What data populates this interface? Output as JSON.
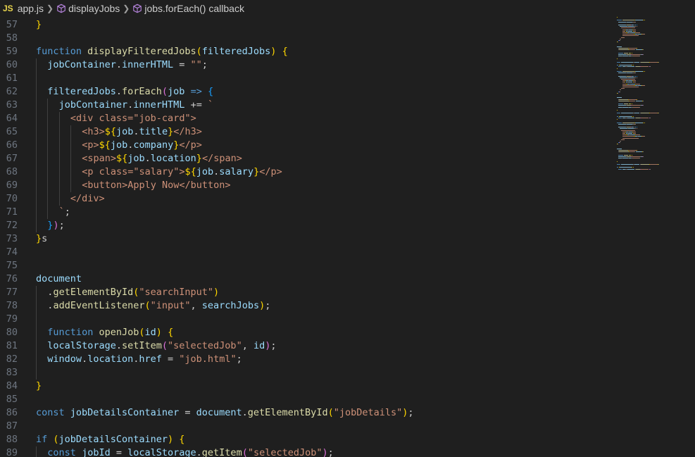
{
  "breadcrumb": {
    "file_badge": "JS",
    "file": "app.js",
    "symbol1": "displayJobs",
    "symbol2": "jobs.forEach() callback",
    "separator": ">",
    "symbol_icon": "cube-icon"
  },
  "colors": {
    "background": "#1f1f1f",
    "keyword": "#569cd6",
    "function": "#dcdcaa",
    "variable": "#9cdcfe",
    "string": "#ce9178",
    "bracket_gold": "#ffd700",
    "bracket_purple": "#da70d6",
    "bracket_blue": "#179fff",
    "line_number": "#6e7681"
  },
  "lines": [
    {
      "n": "57",
      "indent": 0,
      "tokens": [
        [
          "}",
          "b1"
        ]
      ]
    },
    {
      "n": "58",
      "indent": 0,
      "tokens": []
    },
    {
      "n": "59",
      "indent": 0,
      "tokens": [
        [
          "function",
          "kw"
        ],
        [
          " ",
          ""
        ],
        [
          "displayFilteredJobs",
          "fn"
        ],
        [
          "(",
          "b1"
        ],
        [
          "filteredJobs",
          "var"
        ],
        [
          ")",
          "b1"
        ],
        [
          " ",
          ""
        ],
        [
          "{",
          "b1"
        ]
      ]
    },
    {
      "n": "60",
      "indent": 1,
      "tokens": [
        [
          "jobContainer",
          "var"
        ],
        [
          ".",
          ""
        ],
        [
          "innerHTML",
          "var"
        ],
        [
          " = ",
          ""
        ],
        [
          "\"\"",
          "str"
        ],
        [
          ";",
          ""
        ]
      ]
    },
    {
      "n": "61",
      "indent": 1,
      "tokens": []
    },
    {
      "n": "62",
      "indent": 1,
      "tokens": [
        [
          "filteredJobs",
          "var"
        ],
        [
          ".",
          ""
        ],
        [
          "forEach",
          "fn"
        ],
        [
          "(",
          "b2"
        ],
        [
          "job",
          "var"
        ],
        [
          " ",
          ""
        ],
        [
          "=>",
          "kw"
        ],
        [
          " ",
          ""
        ],
        [
          "{",
          "b3"
        ]
      ]
    },
    {
      "n": "63",
      "indent": 2,
      "tokens": [
        [
          "jobContainer",
          "var"
        ],
        [
          ".",
          ""
        ],
        [
          "innerHTML",
          "var"
        ],
        [
          " += ",
          ""
        ],
        [
          "`",
          "str"
        ]
      ]
    },
    {
      "n": "64",
      "indent": 3,
      "tokens": [
        [
          "<div class=\"job-card\">",
          "str"
        ]
      ]
    },
    {
      "n": "65",
      "indent": 4,
      "tokens": [
        [
          "<h3>",
          "str"
        ],
        [
          "${",
          "b1"
        ],
        [
          "job",
          "var"
        ],
        [
          ".",
          ""
        ],
        [
          "title",
          "var"
        ],
        [
          "}",
          "b1"
        ],
        [
          "</h3>",
          "str"
        ]
      ]
    },
    {
      "n": "66",
      "indent": 4,
      "tokens": [
        [
          "<p>",
          "str"
        ],
        [
          "${",
          "b1"
        ],
        [
          "job",
          "var"
        ],
        [
          ".",
          ""
        ],
        [
          "company",
          "var"
        ],
        [
          "}",
          "b1"
        ],
        [
          "</p>",
          "str"
        ]
      ]
    },
    {
      "n": "67",
      "indent": 4,
      "tokens": [
        [
          "<span>",
          "str"
        ],
        [
          "${",
          "b1"
        ],
        [
          "job",
          "var"
        ],
        [
          ".",
          ""
        ],
        [
          "location",
          "var"
        ],
        [
          "}",
          "b1"
        ],
        [
          "</span>",
          "str"
        ]
      ]
    },
    {
      "n": "68",
      "indent": 4,
      "tokens": [
        [
          "<p class=\"salary\">",
          "str"
        ],
        [
          "${",
          "b1"
        ],
        [
          "job",
          "var"
        ],
        [
          ".",
          ""
        ],
        [
          "salary",
          "var"
        ],
        [
          "}",
          "b1"
        ],
        [
          "</p>",
          "str"
        ]
      ]
    },
    {
      "n": "69",
      "indent": 4,
      "tokens": [
        [
          "<button>Apply Now</button>",
          "str"
        ]
      ]
    },
    {
      "n": "70",
      "indent": 3,
      "tokens": [
        [
          "</div>",
          "str"
        ]
      ]
    },
    {
      "n": "71",
      "indent": 2,
      "tokens": [
        [
          "`",
          "str"
        ],
        [
          ";",
          ""
        ]
      ]
    },
    {
      "n": "72",
      "indent": 1,
      "tokens": [
        [
          "}",
          "b3"
        ],
        [
          ")",
          "b2"
        ],
        [
          ";",
          ""
        ]
      ]
    },
    {
      "n": "73",
      "indent": 0,
      "tokens": [
        [
          "}",
          "b1"
        ],
        [
          "s",
          ""
        ]
      ]
    },
    {
      "n": "74",
      "indent": 0,
      "tokens": []
    },
    {
      "n": "75",
      "indent": 0,
      "tokens": []
    },
    {
      "n": "76",
      "indent": 0,
      "tokens": [
        [
          "document",
          "var"
        ]
      ]
    },
    {
      "n": "77",
      "indent": 1,
      "tokens": [
        [
          ".",
          ""
        ],
        [
          "getElementById",
          "fn"
        ],
        [
          "(",
          "b1"
        ],
        [
          "\"searchInput\"",
          "str"
        ],
        [
          ")",
          "b1"
        ]
      ]
    },
    {
      "n": "78",
      "indent": 1,
      "tokens": [
        [
          ".",
          ""
        ],
        [
          "addEventListener",
          "fn"
        ],
        [
          "(",
          "b1"
        ],
        [
          "\"input\"",
          "str"
        ],
        [
          ", ",
          ""
        ],
        [
          "searchJobs",
          "var"
        ],
        [
          ")",
          "b1"
        ],
        [
          ";",
          ""
        ]
      ]
    },
    {
      "n": "79",
      "indent": 1,
      "tokens": []
    },
    {
      "n": "80",
      "indent": 1,
      "tokens": [
        [
          "function",
          "kw"
        ],
        [
          " ",
          ""
        ],
        [
          "openJob",
          "fn"
        ],
        [
          "(",
          "b1"
        ],
        [
          "id",
          "var"
        ],
        [
          ")",
          "b1"
        ],
        [
          " ",
          ""
        ],
        [
          "{",
          "b1"
        ]
      ]
    },
    {
      "n": "81",
      "indent": 1,
      "tokens": [
        [
          "localStorage",
          "var"
        ],
        [
          ".",
          ""
        ],
        [
          "setItem",
          "fn"
        ],
        [
          "(",
          "b2"
        ],
        [
          "\"selectedJob\"",
          "str"
        ],
        [
          ", ",
          ""
        ],
        [
          "id",
          "var"
        ],
        [
          ")",
          "b2"
        ],
        [
          ";",
          ""
        ]
      ]
    },
    {
      "n": "82",
      "indent": 1,
      "tokens": [
        [
          "window",
          "var"
        ],
        [
          ".",
          ""
        ],
        [
          "location",
          "var"
        ],
        [
          ".",
          ""
        ],
        [
          "href",
          "var"
        ],
        [
          " = ",
          ""
        ],
        [
          "\"job.html\"",
          "str"
        ],
        [
          ";",
          ""
        ]
      ]
    },
    {
      "n": "83",
      "indent": 1,
      "tokens": []
    },
    {
      "n": "84",
      "indent": 0,
      "tokens": [
        [
          "}",
          "b1"
        ]
      ]
    },
    {
      "n": "85",
      "indent": 0,
      "tokens": []
    },
    {
      "n": "86",
      "indent": 0,
      "tokens": [
        [
          "const",
          "kw"
        ],
        [
          " ",
          ""
        ],
        [
          "jobDetailsContainer",
          "var"
        ],
        [
          " = ",
          ""
        ],
        [
          "document",
          "var"
        ],
        [
          ".",
          ""
        ],
        [
          "getElementById",
          "fn"
        ],
        [
          "(",
          "b1"
        ],
        [
          "\"jobDetails\"",
          "str"
        ],
        [
          ")",
          "b1"
        ],
        [
          ";",
          ""
        ]
      ]
    },
    {
      "n": "87",
      "indent": 0,
      "tokens": []
    },
    {
      "n": "88",
      "indent": 0,
      "tokens": [
        [
          "if",
          "kw"
        ],
        [
          " ",
          ""
        ],
        [
          "(",
          "b1"
        ],
        [
          "jobDetailsContainer",
          "var"
        ],
        [
          ")",
          "b1"
        ],
        [
          " ",
          ""
        ],
        [
          "{",
          "b1"
        ]
      ]
    },
    {
      "n": "89",
      "indent": 1,
      "tokens": [
        [
          "const",
          "kw"
        ],
        [
          " ",
          ""
        ],
        [
          "jobId",
          "var"
        ],
        [
          " = ",
          ""
        ],
        [
          "localStorage",
          "var"
        ],
        [
          ".",
          ""
        ],
        [
          "getItem",
          "fn"
        ],
        [
          "(",
          "b2"
        ],
        [
          "\"selectedJob\"",
          "str"
        ],
        [
          ")",
          "b2"
        ],
        [
          ";",
          ""
        ]
      ]
    }
  ]
}
